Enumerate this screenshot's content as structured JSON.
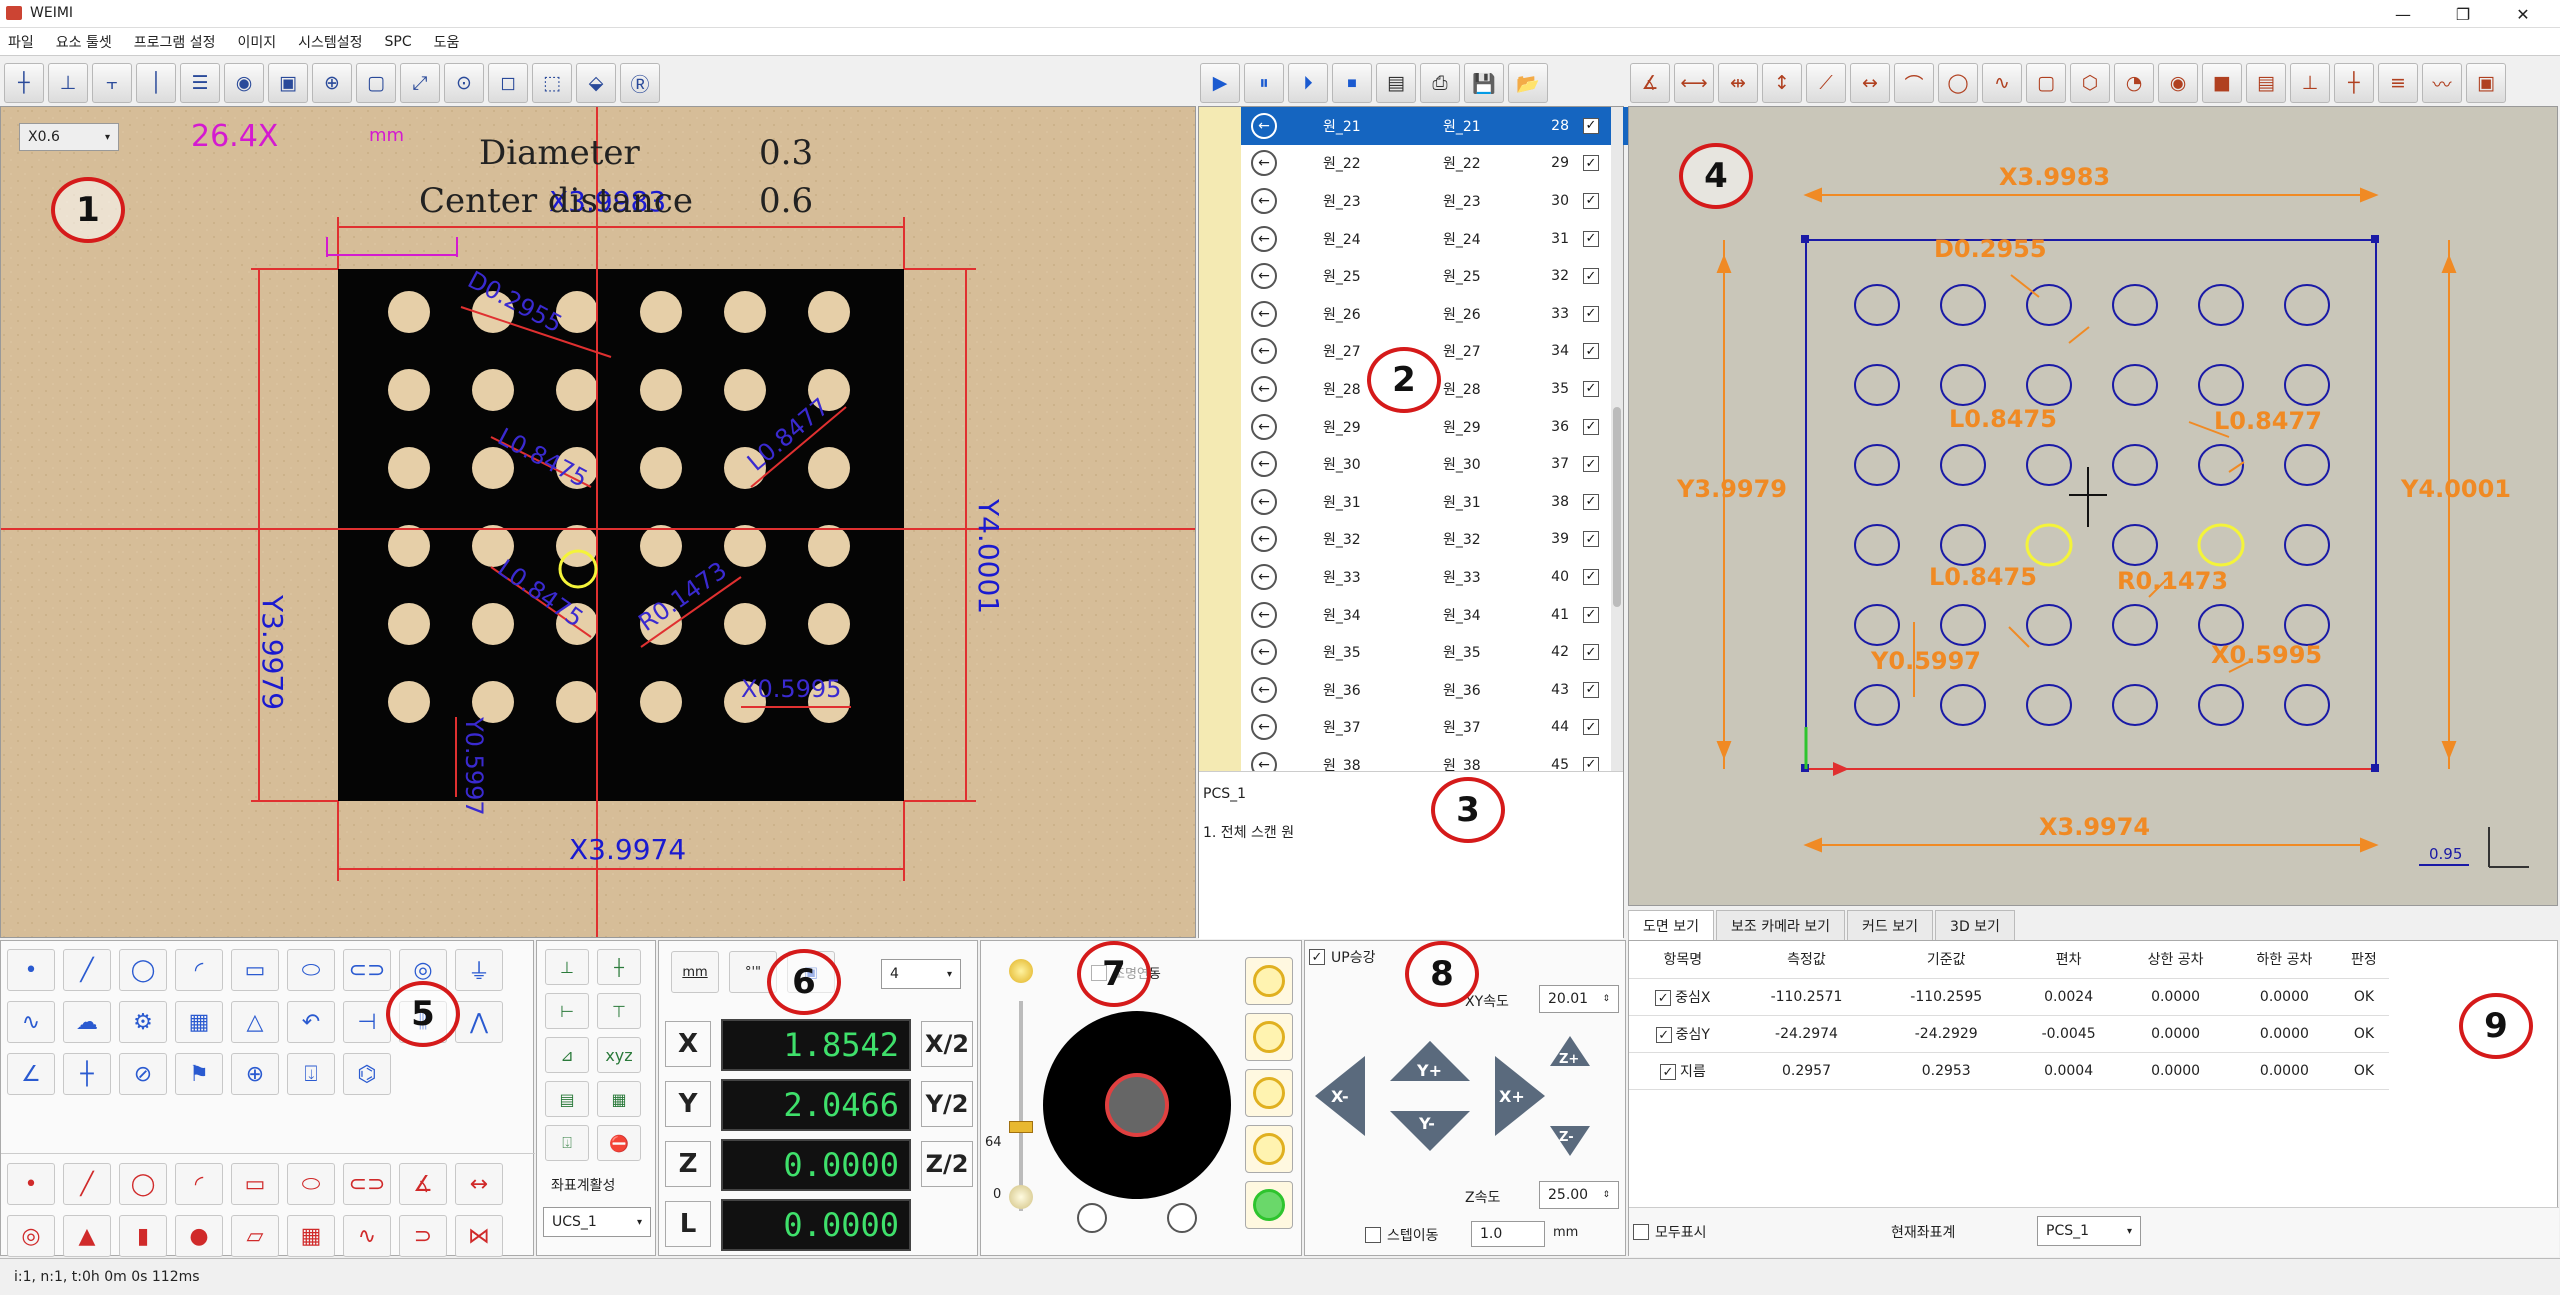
{
  "app": {
    "title": "WEIMI",
    "win_min": "—",
    "win_max": "❐",
    "win_close": "✕"
  },
  "menu": [
    "파일",
    "요소 툴셋",
    "프로그램 설정",
    "이미지",
    "시스템설정",
    "SPC",
    "도움"
  ],
  "camera": {
    "zoom_select": "X0.6",
    "magnification": "26.4X",
    "scale_unit": "mm",
    "info_lines": [
      {
        "label": "Diameter",
        "value": "0.3"
      },
      {
        "label": "Center distance",
        "value": "0.6"
      }
    ],
    "dims": {
      "top": "X3.9983",
      "bottom": "X3.9974",
      "left": "Y3.9979",
      "right": "Y4.0001"
    },
    "dim_small": [
      "D0.2955",
      "L0.8475",
      "L0.8477",
      "L0.8475",
      "R0.1473",
      "X0.5995",
      "Y0.5997"
    ]
  },
  "badges": [
    "1",
    "2",
    "3",
    "4",
    "5",
    "6",
    "7",
    "8",
    "9"
  ],
  "feature_list": {
    "rows": [
      {
        "name": "원_21",
        "ref": "원_21",
        "num": "28",
        "checked": true,
        "selected": true
      },
      {
        "name": "원_22",
        "ref": "원_22",
        "num": "29",
        "checked": true
      },
      {
        "name": "원_23",
        "ref": "원_23",
        "num": "30",
        "checked": true
      },
      {
        "name": "원_24",
        "ref": "원_24",
        "num": "31",
        "checked": true
      },
      {
        "name": "원_25",
        "ref": "원_25",
        "num": "32",
        "checked": true
      },
      {
        "name": "원_26",
        "ref": "원_26",
        "num": "33",
        "checked": true
      },
      {
        "name": "원_27",
        "ref": "원_27",
        "num": "34",
        "checked": true
      },
      {
        "name": "원_28",
        "ref": "원_28",
        "num": "35",
        "checked": true
      },
      {
        "name": "원_29",
        "ref": "원_29",
        "num": "36",
        "checked": true
      },
      {
        "name": "원_30",
        "ref": "원_30",
        "num": "37",
        "checked": true
      },
      {
        "name": "원_31",
        "ref": "원_31",
        "num": "38",
        "checked": true
      },
      {
        "name": "원_32",
        "ref": "원_32",
        "num": "39",
        "checked": true
      },
      {
        "name": "원_33",
        "ref": "원_33",
        "num": "40",
        "checked": true
      },
      {
        "name": "원_34",
        "ref": "원_34",
        "num": "41",
        "checked": true
      },
      {
        "name": "원_35",
        "ref": "원_35",
        "num": "42",
        "checked": true
      },
      {
        "name": "원_36",
        "ref": "원_36",
        "num": "43",
        "checked": true
      },
      {
        "name": "원_37",
        "ref": "원_37",
        "num": "44",
        "checked": true
      },
      {
        "name": "원_38",
        "ref": "원_38",
        "num": "45",
        "checked": true
      }
    ],
    "pcs_label": "PCS_1",
    "scan_label": "1. 전체 스캔 원"
  },
  "view_tabs": [
    "도면 보기",
    "보조 카메라 보기",
    "커드 보기",
    "3D 보기"
  ],
  "cad_scale": "0.95",
  "coords": {
    "unit_btn": "mm",
    "digits_select": "4",
    "x": "1.8542",
    "y": "2.0466",
    "z": "0.0000",
    "l": "0.0000",
    "x_label": "X",
    "y_label": "Y",
    "z_label": "Z",
    "l_label": "L",
    "x_half": "X/2",
    "y_half": "Y/2",
    "z_half": "Z/2",
    "coord_active_label": "좌표계활성",
    "ucs_select": "UCS_1"
  },
  "light": {
    "slider_value": "64",
    "slider_min": "0",
    "checkbox_label": "조명연동",
    "checked": false
  },
  "motion": {
    "up_label": "UP승강",
    "up_checked": true,
    "xy_speed_label": "XY속도",
    "xy_speed": "20.01",
    "z_speed_label": "Z속도",
    "z_speed": "25.00",
    "step_label": "스텝이동",
    "step_checked": false,
    "step_value": "1.0",
    "step_unit": "mm",
    "btn_yplus": "Y+",
    "btn_yminus": "Y-",
    "btn_xminus": "X-",
    "btn_xplus": "X+",
    "btn_zplus": "Z+",
    "btn_zminus": "Z-"
  },
  "results": {
    "headers": [
      "항목명",
      "측정값",
      "기준값",
      "편차",
      "상한 공차",
      "하한 공차",
      "판정"
    ],
    "rows": [
      [
        "중심X",
        "-110.2571",
        "-110.2595",
        "0.0024",
        "0.0000",
        "0.0000",
        "OK"
      ],
      [
        "중심Y",
        "-24.2974",
        "-24.2929",
        "-0.0045",
        "0.0000",
        "0.0000",
        "OK"
      ],
      [
        "지름",
        "0.2957",
        "0.2953",
        "0.0004",
        "0.0000",
        "0.0000",
        "OK"
      ]
    ],
    "show_all_label": "모두표시",
    "current_coord_label": "현재좌표계",
    "pcs_select": "PCS_1"
  },
  "status": "i:1, n:1, t:0h 0m 0s 112ms",
  "colors": {
    "accent_red": "#d51a1a",
    "dim_orange": "#f08a24",
    "cad_blue": "#1a1aa6",
    "dro_green": "#3fe06b",
    "list_select": "#1565c0"
  }
}
